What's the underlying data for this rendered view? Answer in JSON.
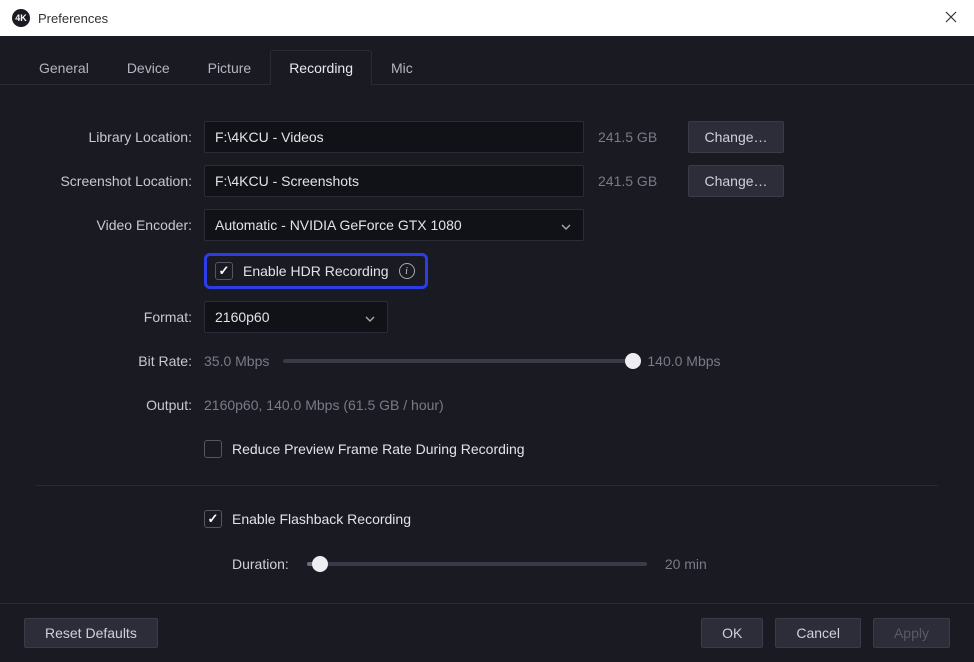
{
  "window": {
    "title": "Preferences",
    "icon_text": "4K"
  },
  "tabs": [
    {
      "label": "General"
    },
    {
      "label": "Device"
    },
    {
      "label": "Picture"
    },
    {
      "label": "Recording"
    },
    {
      "label": "Mic"
    }
  ],
  "active_tab": "Recording",
  "library": {
    "label": "Library Location:",
    "value": "F:\\4KCU - Videos",
    "size": "241.5 GB",
    "change": "Change…"
  },
  "screenshot": {
    "label": "Screenshot Location:",
    "value": "F:\\4KCU - Screenshots",
    "size": "241.5 GB",
    "change": "Change…"
  },
  "encoder": {
    "label": "Video Encoder:",
    "value": "Automatic - NVIDIA GeForce GTX 1080"
  },
  "hdr": {
    "checked": true,
    "label": "Enable HDR Recording"
  },
  "format": {
    "label": "Format:",
    "value": "2160p60"
  },
  "bitrate": {
    "label": "Bit Rate:",
    "min": "35.0 Mbps",
    "max": "140.0 Mbps",
    "pos": 100
  },
  "output": {
    "label": "Output:",
    "text": "2160p60, 140.0 Mbps (61.5 GB / hour)"
  },
  "reduce": {
    "checked": false,
    "label": "Reduce Preview Frame Rate During Recording"
  },
  "flashback": {
    "checked": true,
    "label": "Enable Flashback Recording",
    "duration_label": "Duration:",
    "duration_value": "20 min",
    "duration_pos": 4
  },
  "footer": {
    "reset": "Reset Defaults",
    "ok": "OK",
    "cancel": "Cancel",
    "apply": "Apply"
  }
}
